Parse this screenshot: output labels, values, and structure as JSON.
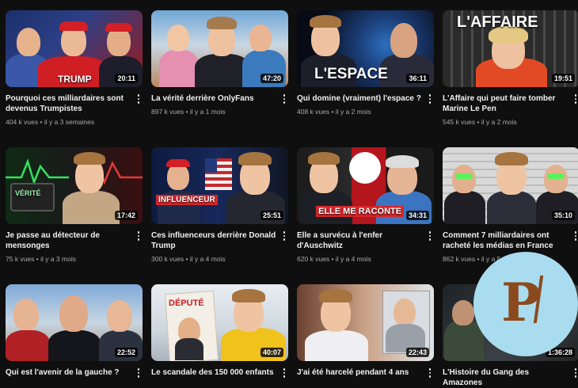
{
  "videos": [
    {
      "title": "Pourquoi ces milliardaires sont devenus Trumpistes",
      "views": "404 k vues",
      "age": "il y a 3 semaines",
      "duration": "20:11",
      "overlay": "TRUMP",
      "overlay2": ""
    },
    {
      "title": "La vérité derrière OnlyFans",
      "views": "897 k vues",
      "age": "il y a 1 mois",
      "duration": "47:20",
      "overlay": "",
      "overlay2": ""
    },
    {
      "title": "Qui domine (vraiment) l'espace ?",
      "views": "408 k vues",
      "age": "il y a 2 mois",
      "duration": "36:11",
      "overlay": "L'ESPACE",
      "overlay2": ""
    },
    {
      "title": "L'Affaire qui peut faire tomber Marine Le Pen",
      "views": "545 k vues",
      "age": "il y a 2 mois",
      "duration": "19:51",
      "overlay": "L'AFFAIRE",
      "overlay2": ""
    },
    {
      "title": "Je passe au détecteur de mensonges",
      "views": "75 k vues",
      "age": "il y a 3 mois",
      "duration": "17:42",
      "overlay": "VÉRITÉ",
      "overlay2": ""
    },
    {
      "title": "Ces influenceurs derrière Donald Trump",
      "views": "300 k vues",
      "age": "il y a 4 mois",
      "duration": "25:51",
      "overlay": "INFLUENCEUR",
      "overlay2": ""
    },
    {
      "title": "Elle a survécu à l'enfer d'Auschwitz",
      "views": "620 k vues",
      "age": "il y a 4 mois",
      "duration": "34:31",
      "overlay": "ELLE ME RACONTE",
      "overlay2": ""
    },
    {
      "title": "Comment 7 milliardaires ont racheté les médias en France",
      "views": "862 k vues",
      "age": "il y a 5 mois",
      "duration": "35:10",
      "overlay": "",
      "overlay2": ""
    },
    {
      "title": "Qui est l'avenir de la gauche ?",
      "views": "",
      "age": "",
      "duration": "22:52",
      "overlay": "",
      "overlay2": ""
    },
    {
      "title": "Le scandale des 150 000 enfants",
      "views": "",
      "age": "",
      "duration": "40:07",
      "overlay": "DÉPUTÉ",
      "overlay2": ""
    },
    {
      "title": "J'ai été harcelé pendant 4 ans",
      "views": "",
      "age": "",
      "duration": "22:43",
      "overlay": "",
      "overlay2": ""
    },
    {
      "title": "L'Histoire du Gang des Amazones",
      "views": "",
      "age": "",
      "duration": "1:36:28",
      "overlay": "",
      "overlay2": ""
    }
  ],
  "colors": {
    "background": "#0f0f0f",
    "text": "#f1f1f1",
    "secondary": "#aaaaaa",
    "logo_bg": "#a9dcef",
    "logo_fg": "#8a4a1e"
  },
  "icons": {
    "more": "more-vert-icon",
    "logo": "channel-logo-p"
  },
  "logo": {
    "letter": "P"
  }
}
